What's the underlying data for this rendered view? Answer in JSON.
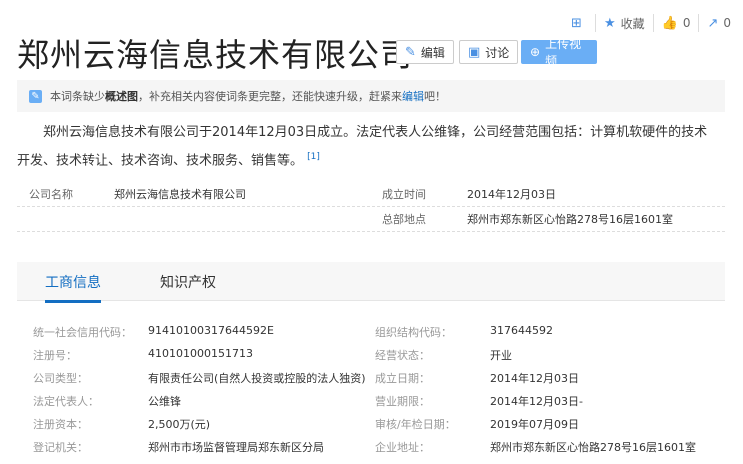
{
  "toolbar": {
    "favorite": "收藏",
    "like_count": "0",
    "share_count": "0"
  },
  "title": "郑州云海信息技术有限公司",
  "buttons": {
    "edit": "编辑",
    "discuss": "讨论",
    "upload": "上传视频"
  },
  "notice": {
    "pre": "本词条缺少",
    "bold": "概述图",
    "mid": "，补充相关内容使词条更完整，还能快速升级，赶紧来",
    "link": "编辑",
    "post": "吧！"
  },
  "summary": {
    "text": "郑州云海信息技术有限公司于2014年12月03日成立。法定代表人公维锋，公司经营范围包括：计算机软硬件的技术开发、技术转让、技术咨询、技术服务、销售等。",
    "ref": "[1]"
  },
  "basic": [
    {
      "l1": "公司名称",
      "v1": "郑州云海信息技术有限公司",
      "l2": "成立时间",
      "v2": "2014年12月03日"
    },
    {
      "l1": "",
      "v1": "",
      "l2": "总部地点",
      "v2": "郑州市郑东新区心怡路278号16层1601室"
    }
  ],
  "tabs": [
    "工商信息",
    "知识产权"
  ],
  "details": [
    {
      "l1": "统一社会信用代码：",
      "v1": "91410100317644592E",
      "l2": "组织结构代码：",
      "v2": "317644592"
    },
    {
      "l1": "注册号：",
      "v1": "410101000151713",
      "l2": "经营状态：",
      "v2": "开业"
    },
    {
      "l1": "公司类型：",
      "v1": "有限责任公司(自然人投资或控股的法人独资)",
      "l2": "成立日期：",
      "v2": "2014年12月03日"
    },
    {
      "l1": "法定代表人：",
      "v1": "公维锋",
      "l2": "营业期限：",
      "v2": "2014年12月03日-"
    },
    {
      "l1": "注册资本：",
      "v1": "2,500万(元)",
      "l2": "审核/年检日期：",
      "v2": "2019年07月09日"
    },
    {
      "l1": "登记机关：",
      "v1": "郑州市市场监督管理局郑东新区分局",
      "l2": "企业地址：",
      "v2": "郑州市郑东新区心怡路278号16层1601室"
    }
  ]
}
